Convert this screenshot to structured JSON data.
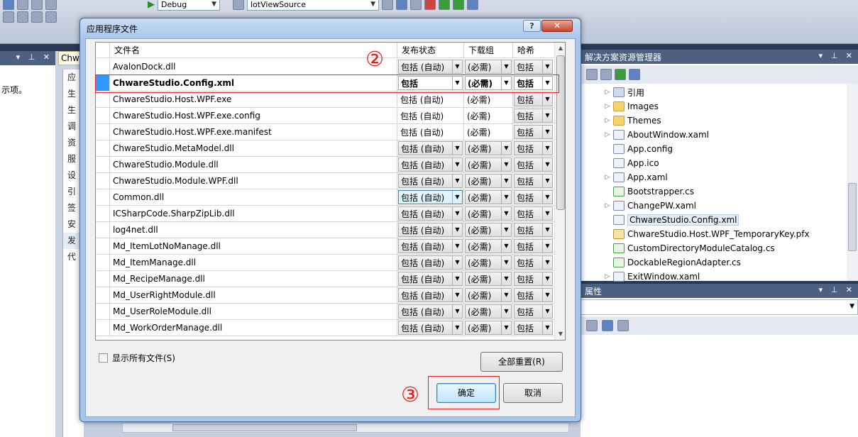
{
  "ide": {
    "config_combo": "Debug",
    "startup_combo": "lotViewSource",
    "left_panel_text": "示项。",
    "doc_tab": "Chw",
    "doc_sidebar_items": [
      "应",
      "生",
      "生",
      "调",
      "资",
      "服",
      "设",
      "引",
      "签",
      "安",
      "发",
      "代"
    ],
    "solution_explorer_title": "解决方案资源管理器",
    "solution_items": [
      {
        "label": "引用",
        "expand": "▷",
        "icon": "ref"
      },
      {
        "label": "Images",
        "expand": "▷",
        "icon": "folder"
      },
      {
        "label": "Themes",
        "expand": "▷",
        "icon": "folder"
      },
      {
        "label": "AboutWindow.xaml",
        "expand": "▷",
        "icon": "file"
      },
      {
        "label": "App.config",
        "expand": "",
        "icon": "file"
      },
      {
        "label": "App.ico",
        "expand": "",
        "icon": "file"
      },
      {
        "label": "App.xaml",
        "expand": "▷",
        "icon": "file"
      },
      {
        "label": "Bootstrapper.cs",
        "expand": "",
        "icon": "cs"
      },
      {
        "label": "ChangePW.xaml",
        "expand": "▷",
        "icon": "file"
      },
      {
        "label": "ChwareStudio.Config.xml",
        "expand": "",
        "icon": "file",
        "selected": true
      },
      {
        "label": "ChwareStudio.Host.WPF_TemporaryKey.pfx",
        "expand": "",
        "icon": "key"
      },
      {
        "label": "CustomDirectoryModuleCatalog.cs",
        "expand": "",
        "icon": "cs"
      },
      {
        "label": "DockableRegionAdapter.cs",
        "expand": "",
        "icon": "cs"
      },
      {
        "label": "ExitWindow.xaml",
        "expand": "▷",
        "icon": "file"
      }
    ],
    "properties_title": "属性",
    "panel_controls": "▾ ⊥ ✕"
  },
  "dialog": {
    "title": "应用程序文件",
    "help_button": "?",
    "close_button": "✕",
    "columns": [
      "文件名",
      "发布状态",
      "下载组",
      "哈希"
    ],
    "rows": [
      {
        "file": "AvalonDock.dll",
        "status": "包括 (自动)",
        "group": "(必需)",
        "hash": "包括",
        "editable": true
      },
      {
        "file": "ChwareStudio.Config.xml",
        "status": "包括",
        "group": "(必需)",
        "hash": "包括",
        "editable": true,
        "selected": true
      },
      {
        "file": "ChwareStudio.Host.WPF.exe",
        "status": "包括 (自动)",
        "group": "(必需)",
        "hash": "包括",
        "editable": false
      },
      {
        "file": "ChwareStudio.Host.WPF.exe.config",
        "status": "包括 (自动)",
        "group": "(必需)",
        "hash": "包括",
        "editable": false
      },
      {
        "file": "ChwareStudio.Host.WPF.exe.manifest",
        "status": "包括 (自动)",
        "group": "(必需)",
        "hash": "包括",
        "editable": false
      },
      {
        "file": "ChwareStudio.MetaModel.dll",
        "status": "包括 (自动)",
        "group": "(必需)",
        "hash": "包括",
        "editable": true
      },
      {
        "file": "ChwareStudio.Module.dll",
        "status": "包括 (自动)",
        "group": "(必需)",
        "hash": "包括",
        "editable": true
      },
      {
        "file": "ChwareStudio.Module.WPF.dll",
        "status": "包括 (自动)",
        "group": "(必需)",
        "hash": "包括",
        "editable": true
      },
      {
        "file": "Common.dll",
        "status": "包括 (自动)",
        "group": "(必需)",
        "hash": "包括",
        "editable": true,
        "focus": true
      },
      {
        "file": "ICSharpCode.SharpZipLib.dll",
        "status": "包括 (自动)",
        "group": "(必需)",
        "hash": "包括",
        "editable": true
      },
      {
        "file": "log4net.dll",
        "status": "包括 (自动)",
        "group": "(必需)",
        "hash": "包括",
        "editable": true
      },
      {
        "file": "Md_ItemLotNoManage.dll",
        "status": "包括 (自动)",
        "group": "(必需)",
        "hash": "包括",
        "editable": true
      },
      {
        "file": "Md_ItemManage.dll",
        "status": "包括 (自动)",
        "group": "(必需)",
        "hash": "包括",
        "editable": true
      },
      {
        "file": "Md_RecipeManage.dll",
        "status": "包括 (自动)",
        "group": "(必需)",
        "hash": "包括",
        "editable": true
      },
      {
        "file": "Md_UserRightModule.dll",
        "status": "包括 (自动)",
        "group": "(必需)",
        "hash": "包括",
        "editable": true
      },
      {
        "file": "Md_UserRoleModule.dll",
        "status": "包括 (自动)",
        "group": "(必需)",
        "hash": "包括",
        "editable": true
      },
      {
        "file": "Md_WorkOrderManage.dll",
        "status": "包括 (自动)",
        "group": "(必需)",
        "hash": "包括",
        "editable": true
      }
    ],
    "show_all_files": "显示所有文件(S)",
    "reset_all": "全部重置(R)",
    "ok": "确定",
    "cancel": "取消"
  },
  "annotations": {
    "step2": "②",
    "step3": "③",
    "color": "#ee1111"
  }
}
